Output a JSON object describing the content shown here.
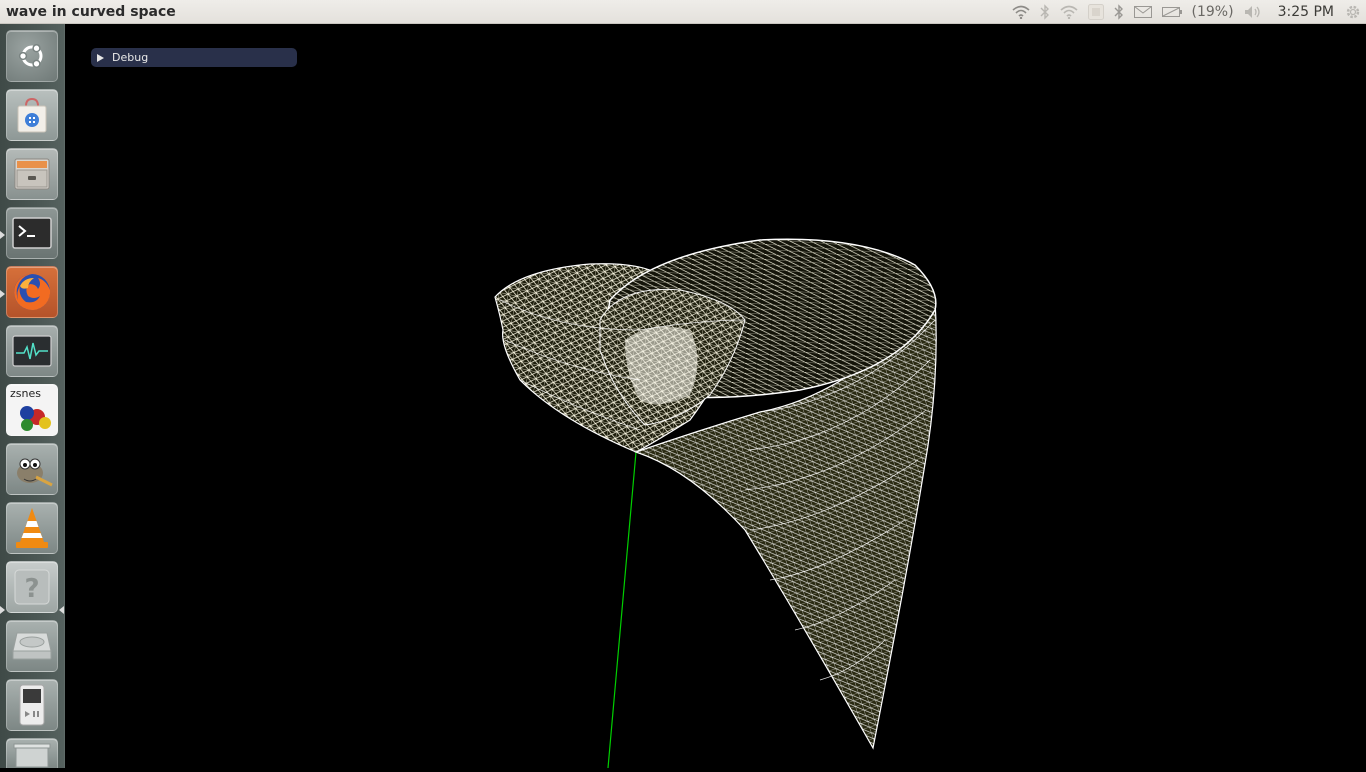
{
  "window": {
    "title": "wave in curved space"
  },
  "top_panel": {
    "battery_percent": "(19%)",
    "clock": "3:25 PM",
    "indicator_icons": [
      "wifi-icon",
      "bluetooth-icon",
      "wifi-icon",
      "keyboard-layout-icon",
      "bluetooth-icon",
      "mail-icon",
      "battery-icon",
      "volume-icon",
      "settings-gear-icon"
    ]
  },
  "launcher": {
    "items": [
      {
        "name": "ubuntu-dash",
        "icon": "ubuntu-logo-icon"
      },
      {
        "name": "software-center",
        "icon": "shopping-bag-icon"
      },
      {
        "name": "files",
        "icon": "file-cabinet-icon"
      },
      {
        "name": "terminal",
        "icon": "terminal-icon",
        "running": true
      },
      {
        "name": "firefox",
        "icon": "firefox-icon",
        "running": true
      },
      {
        "name": "system-monitor",
        "icon": "system-monitor-icon"
      },
      {
        "name": "zsnes",
        "icon": "zsnes-icon",
        "label": "zsnes"
      },
      {
        "name": "gimp",
        "icon": "gimp-icon"
      },
      {
        "name": "vlc",
        "icon": "vlc-cone-icon"
      },
      {
        "name": "unknown-app",
        "icon": "question-mark-icon",
        "label": "?",
        "running": true,
        "focused": true
      },
      {
        "name": "drive",
        "icon": "hard-drive-icon"
      },
      {
        "name": "media-player",
        "icon": "media-player-icon"
      },
      {
        "name": "trash",
        "icon": "trash-icon"
      }
    ]
  },
  "debug_window": {
    "label": "Debug",
    "collapsed": true
  },
  "colors": {
    "background": "#000000",
    "mesh_line": "#ffffff",
    "mesh_fill": "#2a2a14",
    "axis_green": "#00d000",
    "debug_bg": "#29304a"
  }
}
